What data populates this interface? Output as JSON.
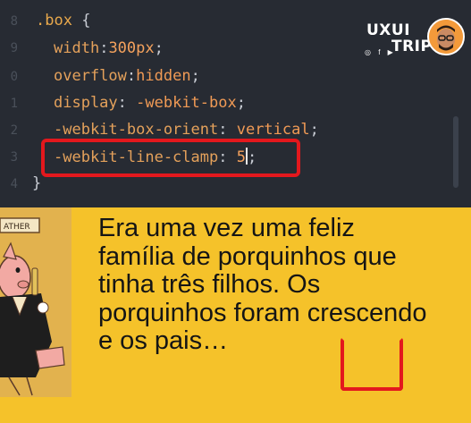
{
  "editor": {
    "line_numbers": [
      "8",
      "9",
      "0",
      "1",
      "2",
      "3",
      "4"
    ],
    "lines": {
      "l1_selector": ".box",
      "l1_brace": " {",
      "l2_prop": "width",
      "l2_colon": ":",
      "l2_value": "300px",
      "l2_semi": ";",
      "l3_prop": "overflow",
      "l3_colon": ":",
      "l3_value": "hidden",
      "l3_semi": ";",
      "l4_prop": "display",
      "l4_colon": ": ",
      "l4_value": "-webkit-box",
      "l4_semi": ";",
      "l5_prop": "-webkit-box-orient",
      "l5_colon": ": ",
      "l5_value": "vertical",
      "l5_semi": ";",
      "l6_prop": "-webkit-line-clamp",
      "l6_colon": ": ",
      "l6_value": "5",
      "l6_semi": ";",
      "l7_brace": "}"
    }
  },
  "logo": {
    "line1": "UXUI",
    "line2": "TRIP",
    "social": "◎ f ▶"
  },
  "slide": {
    "story_text": "Era uma vez uma feliz família de porquinhos que tinha três filhos. Os porquinhos foram crescendo e os pais…",
    "cartoon_sign": "ATHER"
  },
  "colors": {
    "editor_bg": "#272B33",
    "slide_bg": "#F5C22A",
    "highlight_red": "#E3181D"
  }
}
